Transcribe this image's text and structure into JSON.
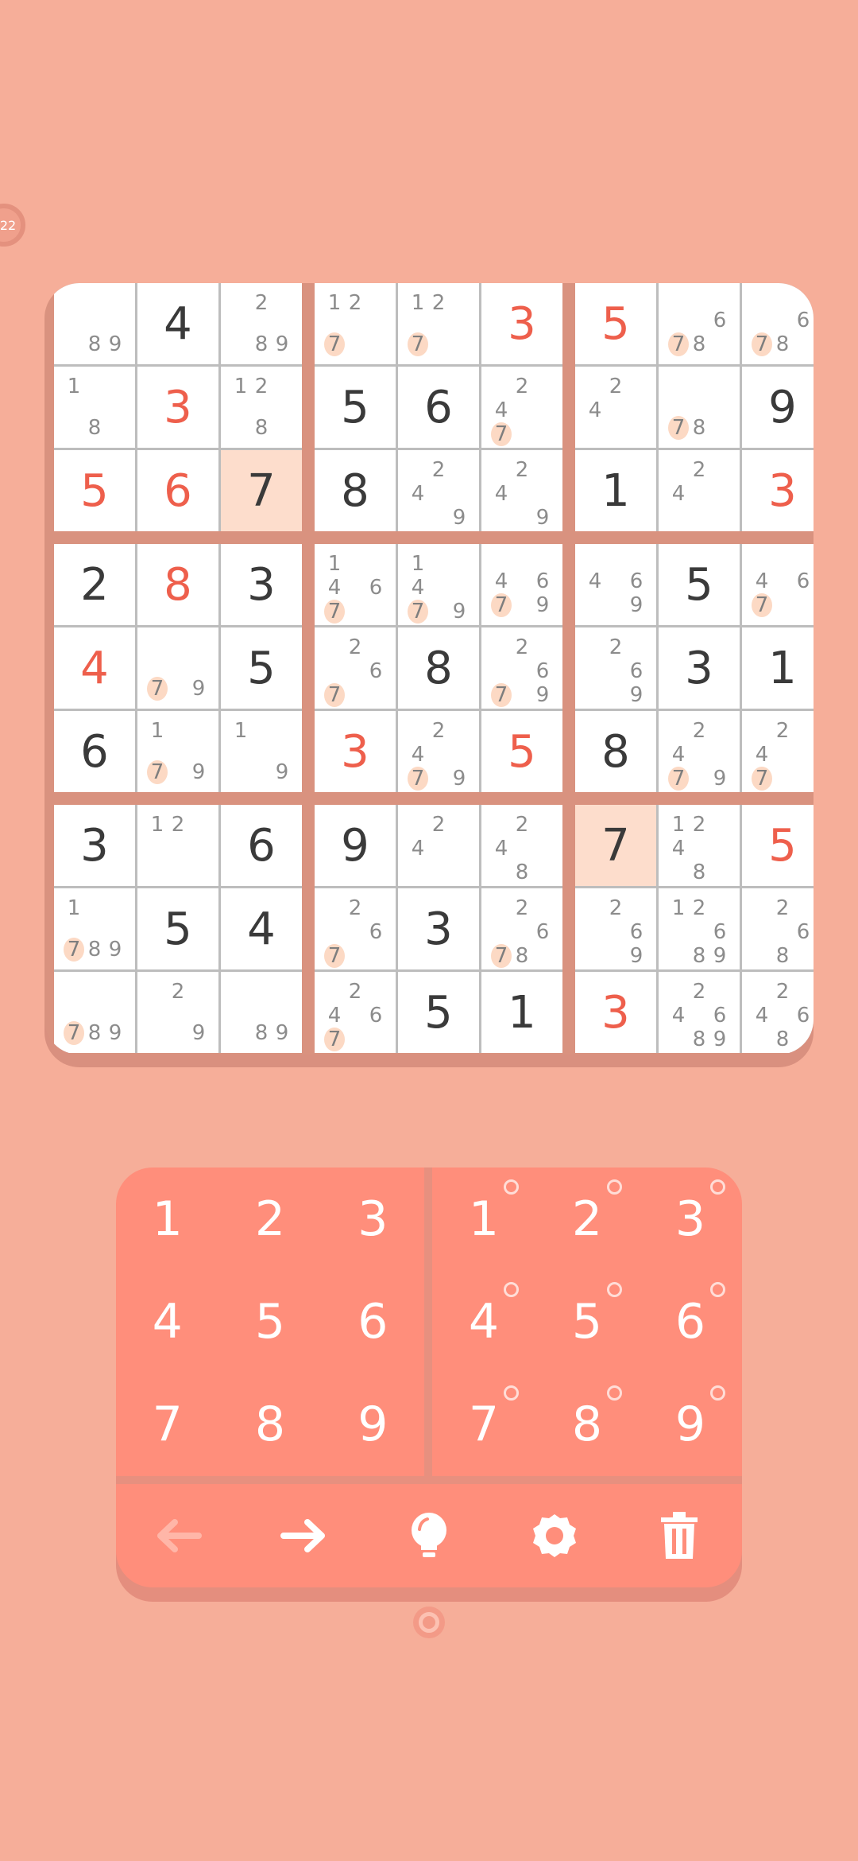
{
  "timer": {
    "label": "22"
  },
  "board": {
    "rows": [
      [
        {
          "n": [
            8,
            9
          ]
        },
        {
          "v": "4",
          "t": "d"
        },
        {
          "n": [
            2,
            8,
            9
          ]
        },
        {
          "n": [
            1,
            2,
            7
          ],
          "h": [
            7
          ]
        },
        {
          "n": [
            1,
            2,
            7
          ],
          "h": [
            7
          ]
        },
        {
          "v": "3",
          "t": "r"
        },
        {
          "v": "5",
          "t": "r"
        },
        {
          "n": [
            6,
            7,
            8
          ],
          "h": [
            7
          ]
        },
        {
          "n": [
            6,
            7,
            8
          ],
          "h": [
            7
          ]
        }
      ],
      [
        {
          "n": [
            1,
            8
          ]
        },
        {
          "v": "3",
          "t": "r"
        },
        {
          "n": [
            1,
            2,
            8
          ]
        },
        {
          "v": "5",
          "t": "d"
        },
        {
          "v": "6",
          "t": "d"
        },
        {
          "n": [
            2,
            4,
            7
          ],
          "h": [
            7
          ]
        },
        {
          "n": [
            2,
            4
          ]
        },
        {
          "n": [
            7,
            8
          ],
          "h": [
            7
          ]
        },
        {
          "v": "9",
          "t": "d"
        }
      ],
      [
        {
          "v": "5",
          "t": "r"
        },
        {
          "v": "6",
          "t": "r"
        },
        {
          "v": "7",
          "t": "d",
          "hl": true
        },
        {
          "v": "8",
          "t": "d"
        },
        {
          "n": [
            2,
            4,
            9
          ]
        },
        {
          "n": [
            2,
            4,
            9
          ]
        },
        {
          "v": "1",
          "t": "d"
        },
        {
          "n": [
            2,
            4
          ]
        },
        {
          "v": "3",
          "t": "r"
        }
      ],
      [
        {
          "v": "2",
          "t": "d"
        },
        {
          "v": "8",
          "t": "r"
        },
        {
          "v": "3",
          "t": "d"
        },
        {
          "n": [
            1,
            4,
            6,
            7
          ],
          "h": [
            7
          ]
        },
        {
          "n": [
            1,
            4,
            7,
            9
          ],
          "h": [
            7
          ]
        },
        {
          "n": [
            4,
            6,
            7,
            9
          ],
          "h": [
            7
          ]
        },
        {
          "n": [
            4,
            6,
            9
          ]
        },
        {
          "v": "5",
          "t": "d"
        },
        {
          "n": [
            4,
            6,
            7
          ],
          "h": [
            7
          ]
        }
      ],
      [
        {
          "v": "4",
          "t": "r"
        },
        {
          "n": [
            7,
            9
          ],
          "h": [
            7
          ]
        },
        {
          "v": "5",
          "t": "d"
        },
        {
          "n": [
            2,
            6,
            7
          ],
          "h": [
            7
          ]
        },
        {
          "v": "8",
          "t": "d"
        },
        {
          "n": [
            2,
            6,
            7,
            9
          ],
          "h": [
            7
          ]
        },
        {
          "n": [
            2,
            6,
            9
          ]
        },
        {
          "v": "3",
          "t": "d"
        },
        {
          "v": "1",
          "t": "d"
        }
      ],
      [
        {
          "v": "6",
          "t": "d"
        },
        {
          "n": [
            1,
            7,
            9
          ],
          "h": [
            7
          ]
        },
        {
          "n": [
            1,
            9
          ]
        },
        {
          "v": "3",
          "t": "r"
        },
        {
          "n": [
            2,
            4,
            7,
            9
          ],
          "h": [
            7
          ]
        },
        {
          "v": "5",
          "t": "r"
        },
        {
          "v": "8",
          "t": "d"
        },
        {
          "n": [
            2,
            4,
            7,
            9
          ],
          "h": [
            7
          ]
        },
        {
          "n": [
            2,
            4,
            7
          ],
          "h": [
            7
          ]
        }
      ],
      [
        {
          "v": "3",
          "t": "d"
        },
        {
          "n": [
            1,
            2
          ]
        },
        {
          "v": "6",
          "t": "d"
        },
        {
          "v": "9",
          "t": "d"
        },
        {
          "n": [
            2,
            4
          ]
        },
        {
          "n": [
            2,
            4,
            8
          ]
        },
        {
          "v": "7",
          "t": "d",
          "hl": true
        },
        {
          "n": [
            1,
            2,
            4,
            8
          ]
        },
        {
          "v": "5",
          "t": "r"
        }
      ],
      [
        {
          "n": [
            1,
            7,
            8,
            9
          ],
          "h": [
            7
          ]
        },
        {
          "v": "5",
          "t": "d"
        },
        {
          "v": "4",
          "t": "d"
        },
        {
          "n": [
            2,
            6,
            7
          ],
          "h": [
            7
          ]
        },
        {
          "v": "3",
          "t": "d"
        },
        {
          "n": [
            2,
            6,
            7,
            8
          ],
          "h": [
            7
          ]
        },
        {
          "n": [
            2,
            6,
            9
          ]
        },
        {
          "n": [
            1,
            2,
            6,
            8,
            9
          ]
        },
        {
          "n": [
            2,
            6,
            8
          ]
        }
      ],
      [
        {
          "n": [
            7,
            8,
            9
          ],
          "h": [
            7
          ]
        },
        {
          "n": [
            2,
            9
          ]
        },
        {
          "n": [
            8,
            9
          ]
        },
        {
          "n": [
            2,
            4,
            6,
            7
          ],
          "h": [
            7
          ]
        },
        {
          "v": "5",
          "t": "d"
        },
        {
          "v": "1",
          "t": "d"
        },
        {
          "v": "3",
          "t": "r"
        },
        {
          "n": [
            2,
            4,
            6,
            8,
            9
          ]
        },
        {
          "n": [
            2,
            4,
            6,
            8
          ]
        }
      ]
    ]
  },
  "keypad": {
    "digits": [
      "1",
      "2",
      "3",
      "4",
      "5",
      "6",
      "7",
      "8",
      "9"
    ],
    "note_digits": [
      "1",
      "2",
      "3",
      "4",
      "5",
      "6",
      "7",
      "8",
      "9"
    ],
    "tools": [
      {
        "name": "undo-icon",
        "enabled": false
      },
      {
        "name": "redo-icon",
        "enabled": true
      },
      {
        "name": "hint-bulb-icon",
        "enabled": true
      },
      {
        "name": "settings-gear-icon",
        "enabled": true
      },
      {
        "name": "trash-erase-icon",
        "enabled": true
      }
    ]
  },
  "colors": {
    "background": "#F6AE99",
    "keypad": "#FF8E7B",
    "given_digit": "#EE5F4C",
    "entered_digit": "#3A3A3A",
    "note": "#8C8C8C",
    "note_highlight": "#FCD9C4",
    "cell_highlight": "#FDDDCC"
  }
}
